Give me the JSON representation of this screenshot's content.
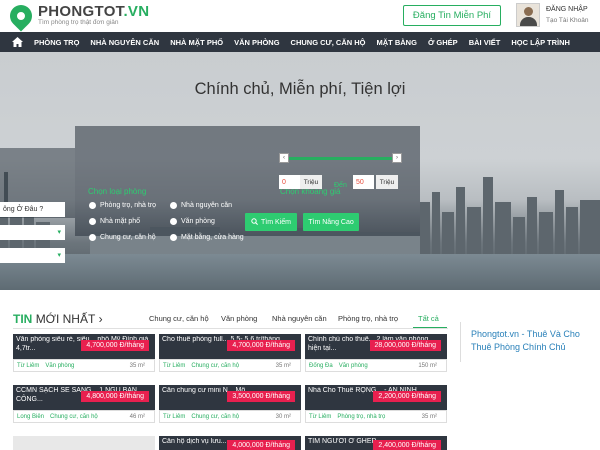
{
  "header": {
    "logo_name": "PHONGTOT",
    "logo_domain": ".VN",
    "logo_tagline": "Tìm phòng trọ thật đơn giản",
    "post_button": "Đăng Tin Miễn Phí",
    "login_label": "ĐĂNG NHẬP",
    "signup_label": "Tạo Tài Khoản"
  },
  "nav": {
    "items": [
      "PHÒNG TRỌ",
      "NHÀ NGUYÊN CĂN",
      "NHÀ MẶT PHỐ",
      "VĂN PHÒNG",
      "CHUNG CƯ, CĂN HỘ",
      "MẶT BẰNG",
      "Ở GHÉP",
      "BÀI VIẾT",
      "HỌC LẬP TRÌNH"
    ]
  },
  "hero": {
    "title": "Chính chủ, Miễn phí, Tiện lợi",
    "location_placeholder": "ông Ở Đâu ?",
    "type_label": "Chọn loại phòng",
    "types": [
      "Phòng trọ, nhà trọ",
      "Nhà nguyên căn",
      "Nhà mặt phố",
      "Văn phòng",
      "Chung cư, căn hộ",
      "Mặt bằng, cửa hàng"
    ],
    "price_label": "Chọn khoảng giá",
    "price_min": "0",
    "price_max": "50",
    "price_unit": "Triệu",
    "price_to": "Đến",
    "search_button": "Tìm Kiếm",
    "advanced_button": "Tìm Nâng Cao"
  },
  "news": {
    "title_highlight": "TIN",
    "title_rest": "MỚI NHẤT",
    "title_arrow": "›",
    "tabs": [
      "Chung cư, căn hộ",
      "Văn phòng",
      "Nhà nguyên căn",
      "Phòng trọ, nhà trọ",
      "Tất cả"
    ],
    "active_tab": "Tất cả",
    "cards": [
      {
        "title": "Văn phòng siêu rẻ, siêu... phố Mỹ Đình giá 4,7tr...",
        "price": "4,700,000 Đ/tháng",
        "loc": "Từ Liêm",
        "cat": "Văn phòng",
        "area": "35 m²"
      },
      {
        "title": "Cho thuê phòng full... 5,5- 5,6 tr/tháng",
        "price": "4,700,000 Đ/tháng",
        "loc": "Từ Liêm",
        "cat": "Chung cư, căn hộ",
        "area": "35 m²"
      },
      {
        "title": "Chính chủ cho thuê... 2 làm văn phòng, hiện tại...",
        "price": "28,000,000 Đ/tháng",
        "loc": "Đống Đa",
        "cat": "Văn phòng",
        "area": "150 m²"
      },
      {
        "title": "CCMN SẠCH SẼ SANG... 1.NGỦ BAN CÔNG...",
        "price": "4,800,000 Đ/tháng",
        "loc": "Long Biên",
        "cat": "Chung cư, căn hộ",
        "area": "46 m²"
      },
      {
        "title": "Căn chung cư mini N... Mỗ",
        "price": "3,500,000 Đ/tháng",
        "loc": "Từ Liêm",
        "cat": "Chung cư, căn hộ",
        "area": "30 m²"
      },
      {
        "title": "Nhà Cho Thuê RỘNG... - AN NINH",
        "price": "2,200,000 Đ/tháng",
        "loc": "Từ Liêm",
        "cat": "Phòng trọ, nhà trọ",
        "area": "35 m²"
      },
      {
        "title": "",
        "price": "",
        "loc": "",
        "cat": "",
        "area": ""
      },
      {
        "title": "Căn hộ dịch vụ lưu...",
        "price": "4,000,000 Đ/tháng",
        "loc": "",
        "cat": "",
        "area": ""
      },
      {
        "title": "TÌM NGƯỜI Ở GHÉP...",
        "price": "2,400,000 Đ/tháng",
        "loc": "",
        "cat": "",
        "area": ""
      }
    ]
  },
  "sidebar": {
    "promo_text": "Phongtot.vn - Thuê Và Cho Thuê Phòng Chính Chủ"
  },
  "colors": {
    "brand_green": "#27ae60",
    "nav_dark": "#2f3640",
    "price_red": "#e8204f",
    "link_blue": "#2980b9"
  }
}
